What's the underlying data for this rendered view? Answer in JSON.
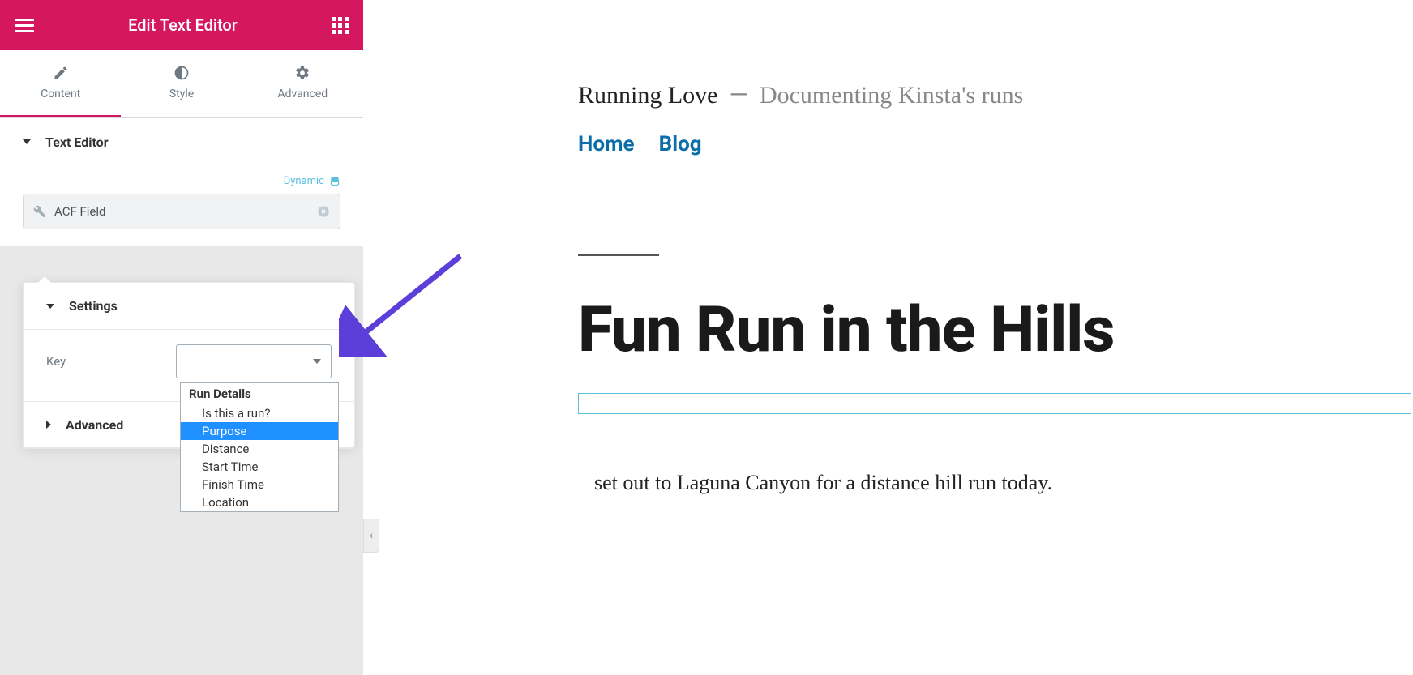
{
  "sidebar": {
    "title": "Edit Text Editor",
    "tabs": [
      {
        "label": "Content"
      },
      {
        "label": "Style"
      },
      {
        "label": "Advanced"
      }
    ],
    "section_text_editor": "Text Editor",
    "dynamic_label": "Dynamic",
    "acf_field_label": "ACF Field",
    "settings_label": "Settings",
    "key_label": "Key",
    "advanced_label": "Advanced",
    "dropdown": {
      "group": "Run Details",
      "options": [
        "Is this a run?",
        "Purpose",
        "Distance",
        "Start Time",
        "Finish Time",
        "Location"
      ],
      "selected_index": 1
    }
  },
  "preview": {
    "site_title": "Running Love",
    "dash": "—",
    "tagline": "Documenting Kinsta's runs",
    "nav": {
      "home": "Home",
      "blog": "Blog"
    },
    "post_title": "Fun Run in the Hills",
    "body": "set out to Laguna Canyon for a distance hill run today.",
    "collapse": "‹"
  }
}
